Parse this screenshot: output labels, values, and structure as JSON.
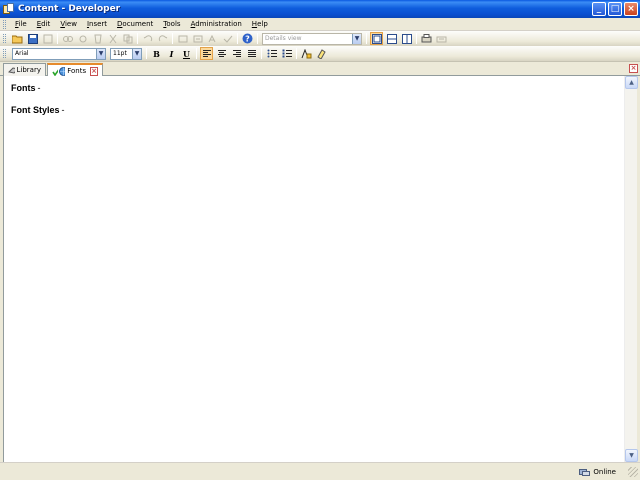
{
  "window": {
    "title": "Content - Developer",
    "buttons": {
      "minimize": "_",
      "maximize": "□",
      "close": "×"
    }
  },
  "menu": {
    "items": [
      {
        "label": "File",
        "mnemonic": "F",
        "rest": "ile"
      },
      {
        "label": "Edit",
        "mnemonic": "E",
        "rest": "dit"
      },
      {
        "label": "View",
        "mnemonic": "V",
        "rest": "iew"
      },
      {
        "label": "Insert",
        "mnemonic": "I",
        "rest": "nsert"
      },
      {
        "label": "Document",
        "mnemonic": "D",
        "rest": "ocument"
      },
      {
        "label": "Tools",
        "mnemonic": "T",
        "rest": "ools"
      },
      {
        "label": "Administration",
        "mnemonic": "A",
        "rest": "dministration"
      },
      {
        "label": "Help",
        "mnemonic": "H",
        "rest": "elp"
      }
    ]
  },
  "toolbar": {
    "view_select": "Details view",
    "view_arrow": "▼"
  },
  "format_toolbar": {
    "font_name": "Arial",
    "font_size": "11pt",
    "arrow": "▼",
    "bold": "B",
    "italic": "I",
    "underline": "U"
  },
  "tabs": [
    {
      "label": "Library",
      "active": false
    },
    {
      "label": "Fonts",
      "active": true
    }
  ],
  "content": {
    "heading1": "Fonts",
    "heading2": "Font Styles",
    "dash": "-"
  },
  "statusbar": {
    "status": "Online"
  },
  "colors": {
    "title_bar": "#0a4fd0",
    "accent_active": "#e68b2c",
    "close_red": "#c75050"
  }
}
